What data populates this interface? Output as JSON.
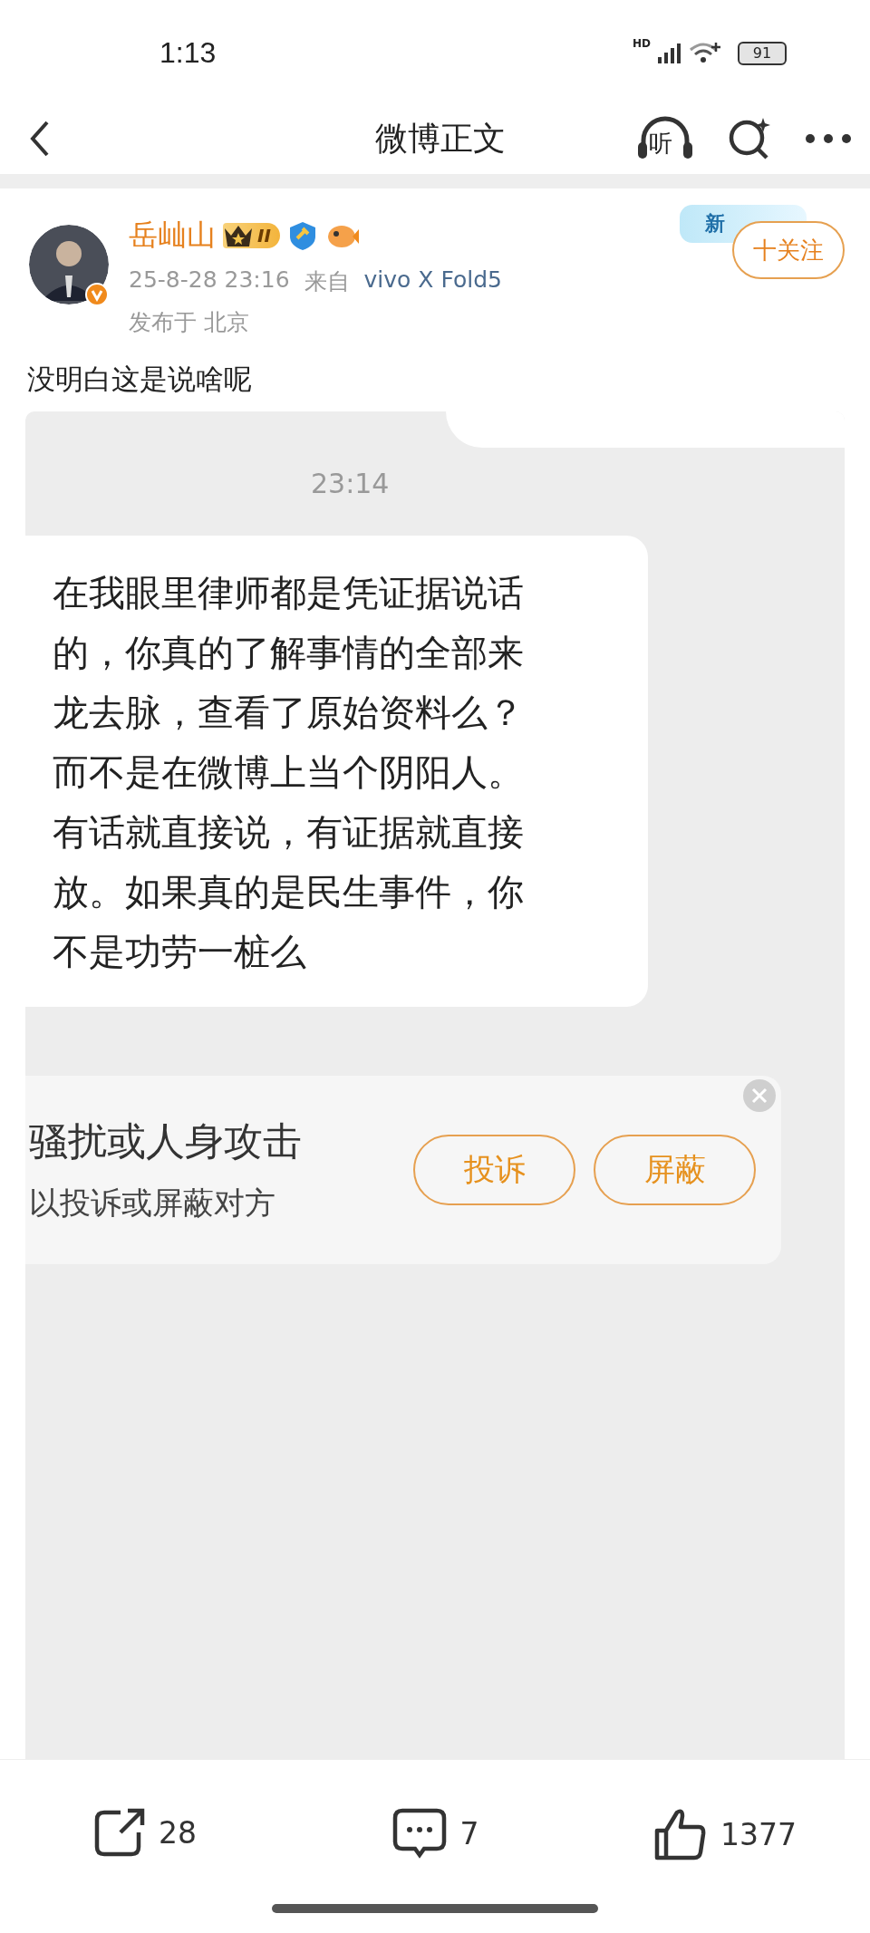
{
  "status_bar": {
    "time": "1:13",
    "network": "HD",
    "battery": "91"
  },
  "nav_bar": {
    "title": "微博正文",
    "listen_label": "听"
  },
  "post": {
    "author": "岳屾山",
    "level_badge": "II",
    "promo_badge": "新",
    "follow_label": "十关注",
    "timestamp": "25-8-28 23:16",
    "source_prefix": "来自",
    "source": "vivo X Fold5",
    "location": "发布于 北京",
    "text": "没明白这是说啥呢",
    "screenshot": {
      "time": "23:14",
      "message": "在我眼里律师都是凭证据说话的，你真的了解事情的全部来龙去脉，查看了原始资料么？而不是在微博上当个阴阳人。有话就直接说，有证据就直接放。如果真的是民生事件，你不是功劳一桩么",
      "notice": {
        "title": "骚扰或人身攻击",
        "subtitle": "以投诉或屏蔽对方",
        "buttons": [
          "投诉",
          "屏蔽"
        ]
      }
    }
  },
  "action_bar": {
    "reposts": "28",
    "comments": "7",
    "likes": "1377"
  }
}
